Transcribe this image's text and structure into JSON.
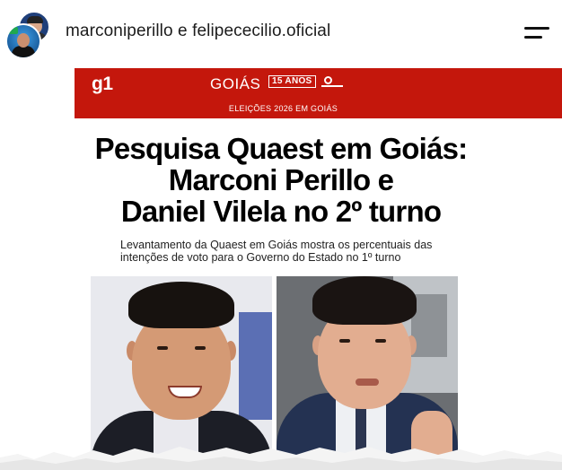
{
  "header": {
    "username": "marconiperillo e felipececilio.oficial",
    "avatar_icon": "avatar-icon",
    "menu_icon": "hamburger-menu-icon"
  },
  "banner": {
    "logo": "g1",
    "region": "GOIÁS",
    "anniversary": "15 ANOS",
    "section": "ELEIÇÕES 2026 EM GOIÁS",
    "color": "#c4170c"
  },
  "article": {
    "headline_line1": "Pesquisa Quaest em Goiás:",
    "headline_line2": "Marconi Perillo e",
    "headline_line3": "Daniel Vilela no 2º turno",
    "subtitle_line1": "Levantamento da Quaest em Goiás mostra os percentuais das",
    "subtitle_line2": "intenções de voto para o Governo do Estado no 1º turno"
  }
}
